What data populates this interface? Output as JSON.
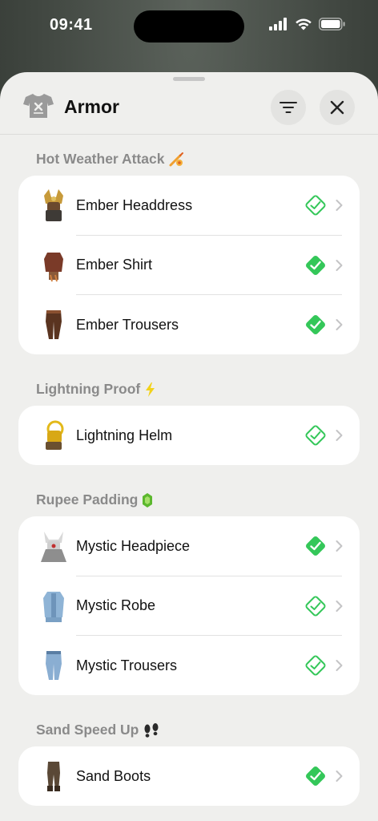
{
  "status_bar": {
    "time": "09:41"
  },
  "header": {
    "title": "Armor",
    "icon": "shirt-icon",
    "filter_icon": "filter-icon",
    "close_icon": "close-icon"
  },
  "colors": {
    "check_green": "#34c759",
    "section_gray": "#8a8a8a"
  },
  "sections": [
    {
      "title": "Hot Weather Attack",
      "icon": "flame-sword-icon",
      "items": [
        {
          "label": "Ember Headdress",
          "checked": false
        },
        {
          "label": "Ember Shirt",
          "checked": true
        },
        {
          "label": "Ember Trousers",
          "checked": true
        }
      ]
    },
    {
      "title": "Lightning Proof",
      "icon": "lightning-icon",
      "items": [
        {
          "label": "Lightning Helm",
          "checked": false
        }
      ]
    },
    {
      "title": "Rupee Padding",
      "icon": "rupee-icon",
      "items": [
        {
          "label": "Mystic Headpiece",
          "checked": true
        },
        {
          "label": "Mystic Robe",
          "checked": false
        },
        {
          "label": "Mystic Trousers",
          "checked": false
        }
      ]
    },
    {
      "title": "Sand Speed Up",
      "icon": "footprints-icon",
      "items": [
        {
          "label": "Sand Boots",
          "checked": true
        }
      ]
    }
  ]
}
